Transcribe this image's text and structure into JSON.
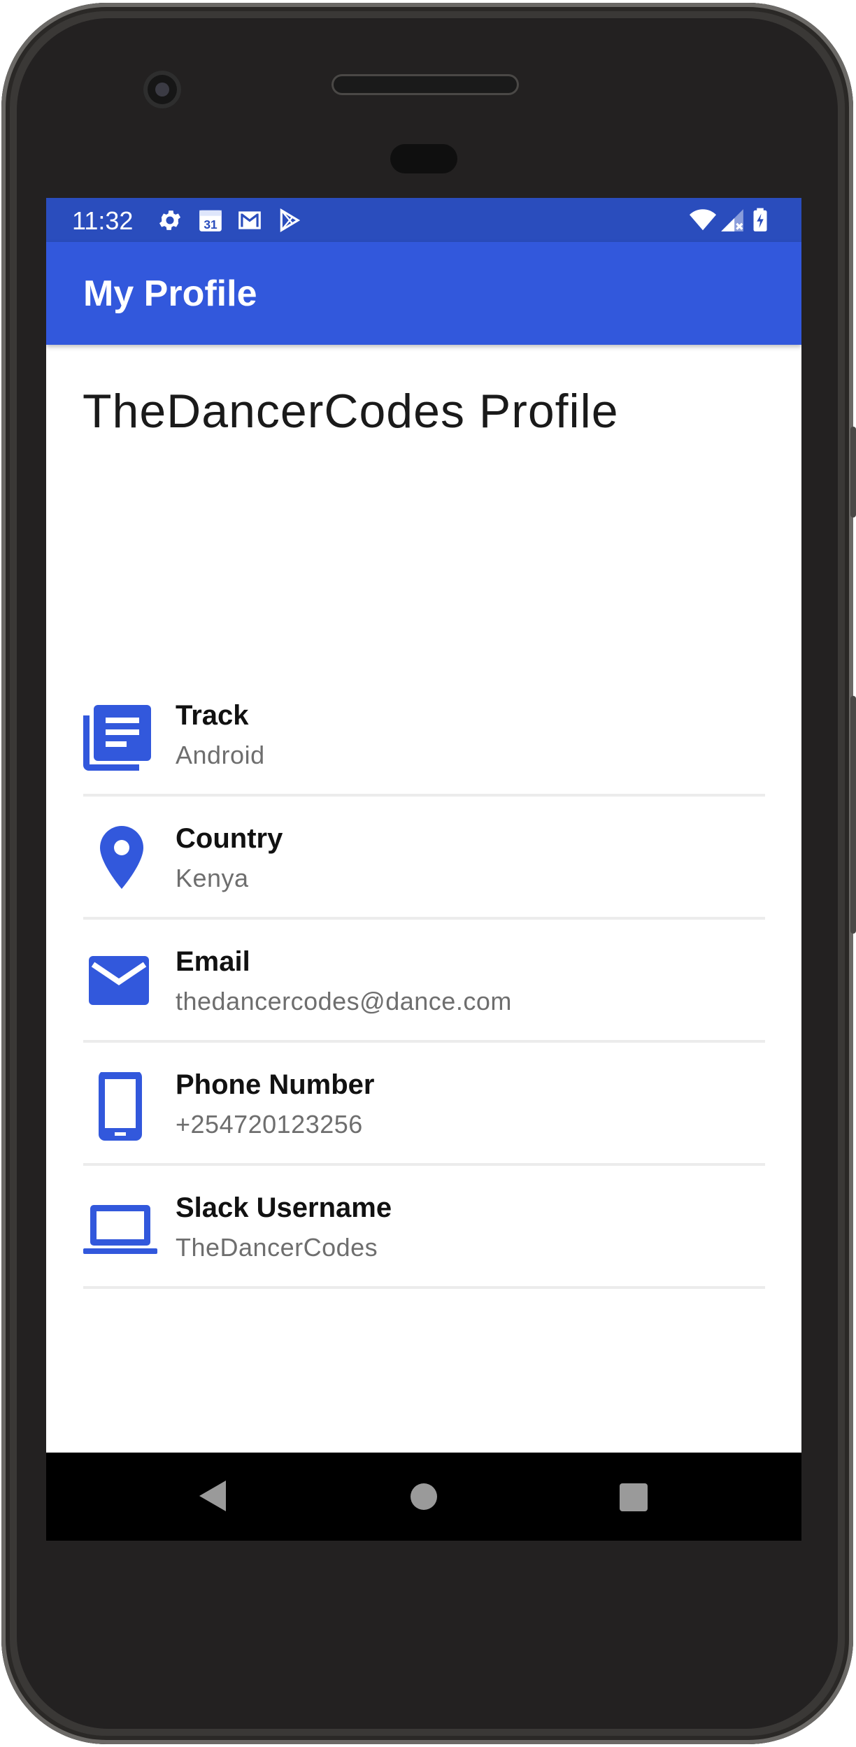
{
  "status_bar": {
    "time": "11:32",
    "calendar_day": "31",
    "left_icons": [
      "gear-icon",
      "calendar-icon",
      "gmail-icon",
      "play-store-icon"
    ],
    "right_icons": [
      "wifi-icon",
      "signal-icon",
      "battery-icon"
    ]
  },
  "app_bar": {
    "title": "My Profile"
  },
  "profile": {
    "title": "TheDancerCodes Profile",
    "rows": [
      {
        "icon": "library-books-icon",
        "label": "Track",
        "value": "Android"
      },
      {
        "icon": "location-pin-icon",
        "label": "Country",
        "value": "Kenya"
      },
      {
        "icon": "email-icon",
        "label": "Email",
        "value": "thedancercodes@dance.com"
      },
      {
        "icon": "smartphone-icon",
        "label": "Phone Number",
        "value": "+254720123256"
      },
      {
        "icon": "laptop-icon",
        "label": "Slack Username",
        "value": "TheDancerCodes"
      }
    ]
  },
  "nav_bar": {
    "buttons": [
      "back-icon",
      "home-icon",
      "recent-apps-icon"
    ]
  },
  "colors": {
    "primary": "#3258dc",
    "primary_dark": "#2a4dbd",
    "icon": "#3258dc"
  }
}
